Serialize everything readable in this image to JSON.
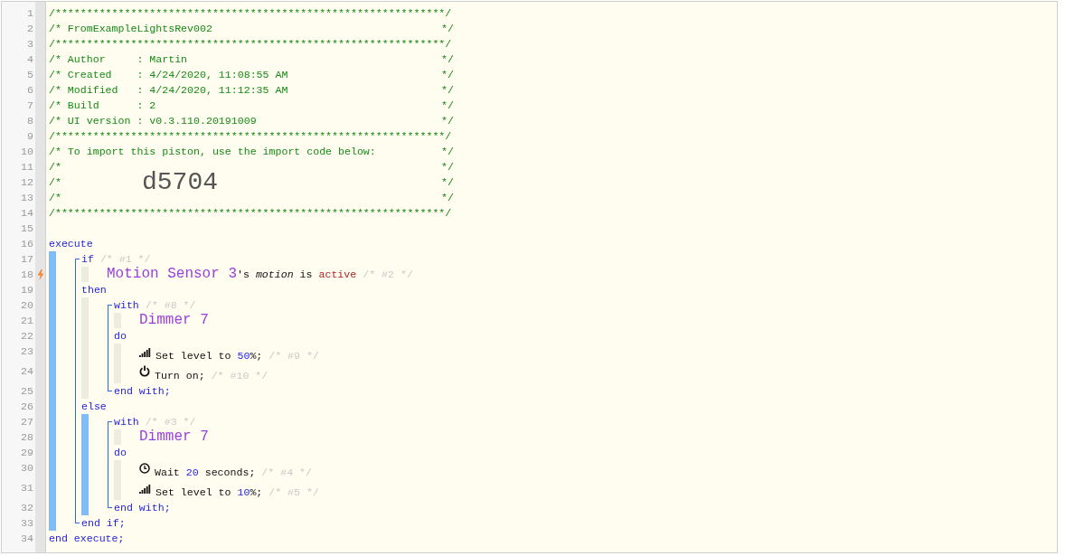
{
  "editor": {
    "header": [
      {
        "number": "1",
        "text": "/**************************************************************/"
      },
      {
        "number": "2",
        "text": "/* FromExampleLightsRev002",
        "end": "*/"
      },
      {
        "number": "3",
        "text": "/**************************************************************/"
      },
      {
        "number": "4",
        "text": "/* Author     : Martin",
        "end": "*/"
      },
      {
        "number": "5",
        "text": "/* Created    : 4/24/2020, 11:08:55 AM",
        "end": "*/"
      },
      {
        "number": "6",
        "text": "/* Modified   : 4/24/2020, 11:12:35 AM",
        "end": "*/"
      },
      {
        "number": "7",
        "text": "/* Build      : 2",
        "end": "*/"
      },
      {
        "number": "8",
        "text": "/* UI version : v0.3.110.20191009",
        "end": "*/"
      },
      {
        "number": "9",
        "text": "/**************************************************************/"
      },
      {
        "number": "10",
        "text": "/* To import this piston, use the import code below:",
        "end": "*/"
      },
      {
        "number": "11",
        "text": "/*",
        "end": "*/"
      },
      {
        "number": "12",
        "text": "/*",
        "code": "d5704",
        "end": "*/"
      },
      {
        "number": "13",
        "text": "/*",
        "end": "*/"
      },
      {
        "number": "14",
        "text": "/**************************************************************/"
      },
      {
        "number": "15"
      }
    ],
    "program": [
      {
        "kind": "line",
        "number": "16",
        "trigger": false,
        "tokens": [
          {
            "kind": "keyword",
            "text": "execute"
          }
        ]
      },
      {
        "kind": "bar",
        "highlighted": true,
        "children": [
          {
            "kind": "bracket",
            "children": [
              {
                "kind": "line",
                "number": "17",
                "trigger": false,
                "tokens": [
                  {
                    "kind": "keyword",
                    "text": "if "
                  },
                  {
                    "kind": "comment",
                    "text": "/* #1 */"
                  }
                ]
              },
              {
                "kind": "bar",
                "highlighted": false,
                "children": [
                  {
                    "kind": "line",
                    "number": "18",
                    "trigger": true,
                    "tokens": [
                      {
                        "kind": "device",
                        "text": "Motion Sensor 3"
                      },
                      {
                        "kind": "text",
                        "text": "'s "
                      },
                      {
                        "kind": "attribute",
                        "text": "motion"
                      },
                      {
                        "kind": "text",
                        "text": " is "
                      },
                      {
                        "kind": "value",
                        "text": "active"
                      },
                      {
                        "kind": "comment",
                        "text": "/* #2 */"
                      }
                    ]
                  }
                ]
              },
              {
                "kind": "line",
                "number": "19",
                "trigger": false,
                "tokens": [
                  {
                    "kind": "keyword",
                    "text": "then"
                  }
                ]
              },
              {
                "kind": "bar",
                "highlighted": false,
                "children": [
                  {
                    "kind": "bracket",
                    "children": [
                      {
                        "kind": "line",
                        "number": "20",
                        "trigger": false,
                        "tokens": [
                          {
                            "kind": "keyword",
                            "text": "with "
                          },
                          {
                            "kind": "comment",
                            "text": "/* #8 */"
                          }
                        ]
                      },
                      {
                        "kind": "bar",
                        "highlighted": false,
                        "children": [
                          {
                            "kind": "line",
                            "number": "21",
                            "trigger": false,
                            "tokens": [
                              {
                                "kind": "device",
                                "text": "Dimmer 7"
                              }
                            ]
                          }
                        ]
                      },
                      {
                        "kind": "line",
                        "number": "22",
                        "trigger": false,
                        "tokens": [
                          {
                            "kind": "keyword",
                            "text": "do"
                          }
                        ]
                      },
                      {
                        "kind": "bar",
                        "highlighted": false,
                        "children": [
                          {
                            "kind": "line",
                            "number": "23",
                            "trigger": false,
                            "tokens": [
                              {
                                "kind": "signal"
                              },
                              {
                                "kind": "text",
                                "text": "Set level to "
                              },
                              {
                                "kind": "number",
                                "text": "50"
                              },
                              {
                                "kind": "text",
                                "text": "%; "
                              },
                              {
                                "kind": "comment",
                                "text": "/* #9 */"
                              }
                            ]
                          },
                          {
                            "kind": "line",
                            "number": "24",
                            "trigger": false,
                            "tokens": [
                              {
                                "kind": "power"
                              },
                              {
                                "kind": "text",
                                "text": "Turn on; "
                              },
                              {
                                "kind": "comment",
                                "text": "/* #10 */"
                              }
                            ]
                          }
                        ]
                      },
                      {
                        "kind": "line",
                        "number": "25",
                        "trigger": false,
                        "tokens": [
                          {
                            "kind": "keyword",
                            "text": "end with;"
                          }
                        ]
                      }
                    ]
                  }
                ]
              },
              {
                "kind": "line",
                "number": "26",
                "trigger": false,
                "tokens": [
                  {
                    "kind": "keyword",
                    "text": "else"
                  }
                ]
              },
              {
                "kind": "bar",
                "highlighted": true,
                "children": [
                  {
                    "kind": "bracket",
                    "children": [
                      {
                        "kind": "line",
                        "number": "27",
                        "trigger": false,
                        "tokens": [
                          {
                            "kind": "keyword",
                            "text": "with "
                          },
                          {
                            "kind": "comment",
                            "text": "/* #3 */"
                          }
                        ]
                      },
                      {
                        "kind": "bar",
                        "highlighted": false,
                        "children": [
                          {
                            "kind": "line",
                            "number": "28",
                            "trigger": false,
                            "tokens": [
                              {
                                "kind": "device",
                                "text": "Dimmer 7"
                              }
                            ]
                          }
                        ]
                      },
                      {
                        "kind": "line",
                        "number": "29",
                        "trigger": false,
                        "tokens": [
                          {
                            "kind": "keyword",
                            "text": "do"
                          }
                        ]
                      },
                      {
                        "kind": "bar",
                        "highlighted": false,
                        "children": [
                          {
                            "kind": "line",
                            "number": "30",
                            "trigger": false,
                            "tokens": [
                              {
                                "kind": "clock"
                              },
                              {
                                "kind": "text",
                                "text": "Wait "
                              },
                              {
                                "kind": "number",
                                "text": "20"
                              },
                              {
                                "kind": "text",
                                "text": " seconds; "
                              },
                              {
                                "kind": "comment",
                                "text": "/* #4 */"
                              }
                            ]
                          },
                          {
                            "kind": "line",
                            "number": "31",
                            "trigger": false,
                            "tokens": [
                              {
                                "kind": "signal"
                              },
                              {
                                "kind": "text",
                                "text": "Set level to "
                              },
                              {
                                "kind": "number",
                                "text": "10"
                              },
                              {
                                "kind": "text",
                                "text": "%; "
                              },
                              {
                                "kind": "comment",
                                "text": "/* #5 */"
                              }
                            ]
                          }
                        ]
                      },
                      {
                        "kind": "line",
                        "number": "32",
                        "trigger": false,
                        "tokens": [
                          {
                            "kind": "keyword",
                            "text": "end with;"
                          }
                        ]
                      }
                    ]
                  }
                ]
              },
              {
                "kind": "line",
                "number": "33",
                "trigger": false,
                "tokens": [
                  {
                    "kind": "keyword",
                    "text": "end if;"
                  }
                ]
              }
            ]
          }
        ]
      },
      {
        "kind": "line",
        "number": "34",
        "trigger": false,
        "tokens": [
          {
            "kind": "keyword",
            "text": "end execute;"
          }
        ]
      }
    ]
  }
}
